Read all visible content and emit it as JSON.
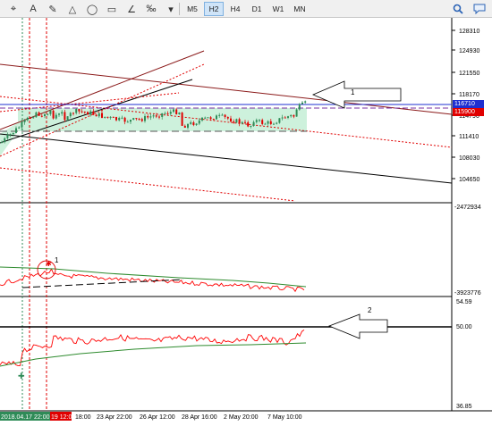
{
  "toolbar": {
    "tools": [
      {
        "icon": "crosshair-icon",
        "glyph": "⌖"
      },
      {
        "icon": "text-tool-icon",
        "glyph": "A"
      },
      {
        "icon": "pen-tool-icon",
        "glyph": "✎"
      },
      {
        "icon": "triangle-tool-icon",
        "glyph": "△"
      },
      {
        "icon": "ellipse-tool-icon",
        "glyph": "◯"
      },
      {
        "icon": "rectangle-tool-icon",
        "glyph": "▭"
      },
      {
        "icon": "angle-tool-icon",
        "glyph": "∠"
      },
      {
        "icon": "shapes-menu-icon",
        "glyph": "‰"
      },
      {
        "icon": "dropdown-arrow-icon",
        "glyph": "▾"
      }
    ],
    "timeframes": [
      "M5",
      "H2",
      "H4",
      "D1",
      "W1",
      "MN"
    ],
    "active_timeframe": "H2",
    "search_icon": "search-icon",
    "chat_icon": "chat-icon"
  },
  "price_panel": {
    "price_labels": [
      "128310",
      "124930",
      "121550",
      "118170",
      "114790",
      "111410",
      "108030",
      "104650"
    ],
    "badge_upper": "116710",
    "badge_lower": "115900",
    "badge_upper_color": "#1e2fd0",
    "badge_lower_color": "#e00000",
    "annotation": "1"
  },
  "oscillator_panel": {
    "top_label": "-2472934",
    "bottom_label": "-3923776",
    "annotation": "1"
  },
  "rsi_panel": {
    "labels": [
      "54.59",
      "50.00",
      "36.85"
    ],
    "annotation": "2"
  },
  "time_axis": {
    "highlight_green": "2018.04.17 22:00",
    "highlight_red": "19 12:00",
    "labels": [
      "18:00",
      "23 Apr 22:00",
      "26 Apr 12:00",
      "28 Apr 16:00",
      "2 May 20:00",
      "7 May 10:00"
    ]
  },
  "colors": {
    "up_candle": "#2e8b57",
    "down_candle": "#e00000",
    "channel_fill": "#c8f0d8",
    "rsi_line": "#ff0000",
    "ma_line": "#2e8b2e"
  }
}
